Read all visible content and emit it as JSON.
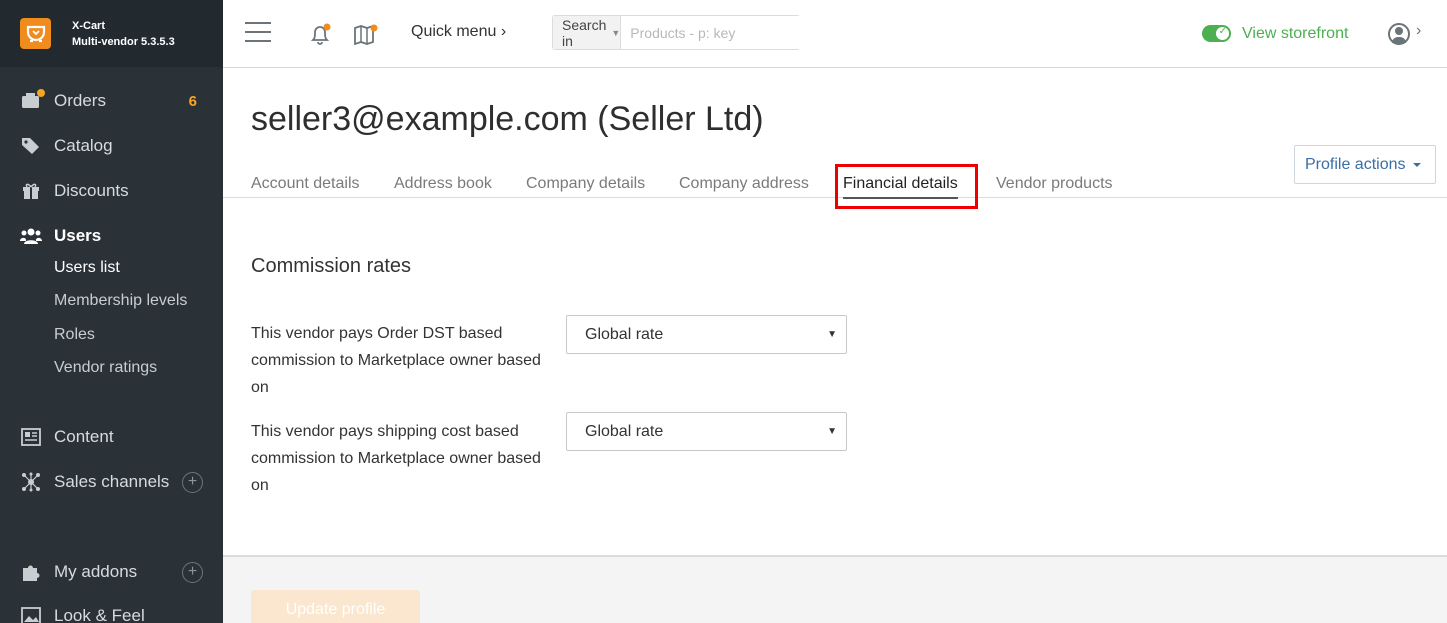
{
  "brand": {
    "name": "X-Cart",
    "version": "Multi-vendor 5.3.5.3"
  },
  "sidebar": {
    "items": [
      {
        "label": "Orders",
        "count": "6"
      },
      {
        "label": "Catalog"
      },
      {
        "label": "Discounts"
      },
      {
        "label": "Users"
      },
      {
        "label": "Content"
      },
      {
        "label": "Sales channels"
      },
      {
        "label": "My addons"
      },
      {
        "label": "Look & Feel"
      }
    ],
    "users_sub": [
      "Users list",
      "Membership levels",
      "Roles",
      "Vendor ratings"
    ]
  },
  "header": {
    "quick_menu": "Quick menu ›",
    "search_in": "Search in",
    "search_placeholder": "Products - p: key",
    "view_storefront": "View storefront"
  },
  "page": {
    "title": "seller3@example.com (Seller Ltd)",
    "profile_actions": "Profile actions",
    "tabs": [
      "Account details",
      "Address book",
      "Company details",
      "Company address",
      "Financial details",
      "Vendor products"
    ],
    "active_tab": "Financial details"
  },
  "commission": {
    "section_title": "Commission rates",
    "fields": [
      {
        "label": "This vendor pays Order DST based commission to Marketplace owner based on",
        "value": "Global rate"
      },
      {
        "label": "This vendor pays shipping cost based commission to Marketplace owner based on",
        "value": "Global rate"
      }
    ]
  },
  "footer": {
    "update_button": "Update profile"
  },
  "colors": {
    "accent": "#f08c1e",
    "sidebar_bg": "#2a3238",
    "green": "#4caf50",
    "highlight": "#e00000"
  }
}
